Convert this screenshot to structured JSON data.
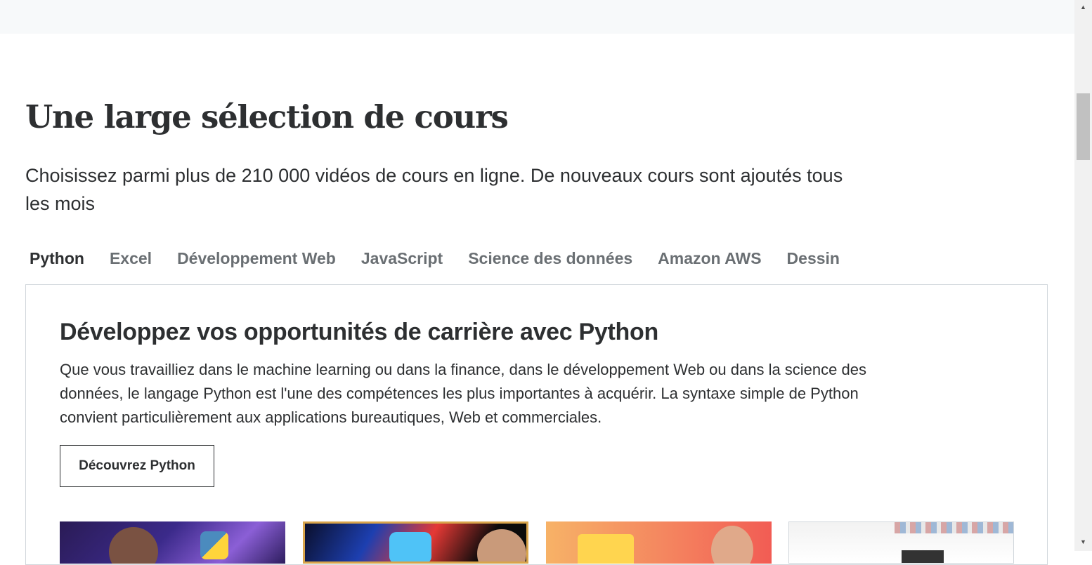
{
  "section": {
    "title": "Une large sélection de cours",
    "subtitle": "Choisissez parmi plus de 210 000 vidéos de cours en ligne. De nouveaux cours sont ajoutés tous les mois"
  },
  "tabs": [
    {
      "label": "Python",
      "active": true
    },
    {
      "label": "Excel",
      "active": false
    },
    {
      "label": "Développement Web",
      "active": false
    },
    {
      "label": "JavaScript",
      "active": false
    },
    {
      "label": "Science des données",
      "active": false
    },
    {
      "label": "Amazon AWS",
      "active": false
    },
    {
      "label": "Dessin",
      "active": false
    }
  ],
  "panel": {
    "title": "Développez vos opportunités de carrière avec Python",
    "description": "Que vous travailliez dans le machine learning ou dans la finance, dans le développement Web ou dans la science des données, le langage Python est l'une des compétences les plus importantes à acquérir. La syntaxe simple de Python convient particulièrement aux applications bureautiques, Web et commerciales.",
    "cta_label": "Découvrez Python"
  },
  "colors": {
    "text": "#2d2f31",
    "tab_inactive": "#6a6f73",
    "border": "#d1d7dc",
    "topbar": "#f7f9fa"
  }
}
